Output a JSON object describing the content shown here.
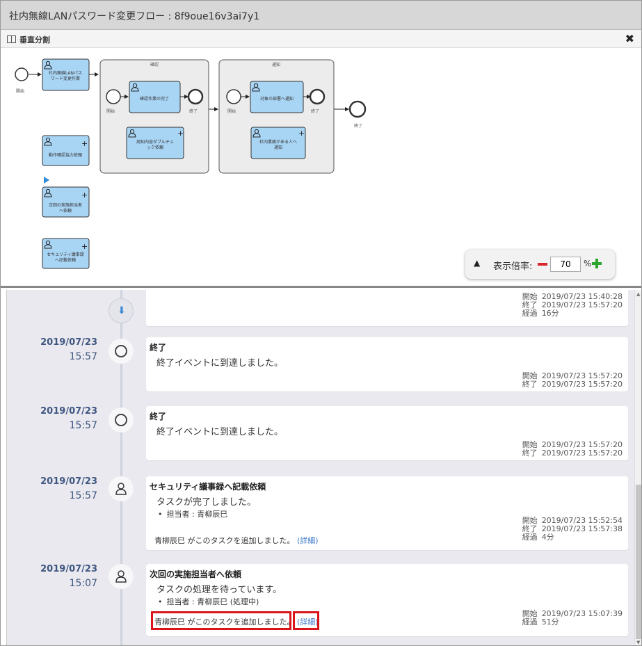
{
  "window": {
    "title": "社内無線LANパスワード変更フロー : 8f9oue16v3ai7y1"
  },
  "toolbar": {
    "split_label": "垂直分割",
    "close_label": "✖"
  },
  "diagram": {
    "start_label": "開始",
    "task1": [
      "社内無線LANパス",
      "ワード変更作業"
    ],
    "group1_title": "確認",
    "group1_start": "開始",
    "group1_task": "確認作業の完了",
    "group1_end": "終了",
    "group1_task2": [
      "周知内容ダブルチェ",
      "ック依頼"
    ],
    "group2_title": "通知",
    "group2_start": "開始",
    "group2_task": "対象の部署へ通知",
    "group2_end": "終了",
    "group2_task2": [
      "社内業務がある人へ",
      "通知"
    ],
    "end_label": "終了",
    "side_task1": "動作確認協力依頼",
    "side_task2": [
      "次回の実施担当者",
      "へ依頼"
    ],
    "side_task3": [
      "セキュリティ議事録",
      "へ記載依頼"
    ]
  },
  "zoom": {
    "label": "表示倍率:",
    "value": "70",
    "unit": "%"
  },
  "timeline": {
    "first": {
      "stats": [
        {
          "k": "開始",
          "v": "2019/07/23 15:40:28"
        },
        {
          "k": "終了",
          "v": "2019/07/23 15:57:20"
        },
        {
          "k": "経過",
          "v": "16分"
        }
      ]
    },
    "entries": [
      {
        "date": "2019/07/23",
        "time": "15:57",
        "title": "終了",
        "message": "終了イベントに到達しました。",
        "stats": [
          {
            "k": "開始",
            "v": "2019/07/23 15:57:20"
          },
          {
            "k": "終了",
            "v": "2019/07/23 15:57:20"
          }
        ]
      },
      {
        "date": "2019/07/23",
        "time": "15:57",
        "title": "終了",
        "message": "終了イベントに到達しました。",
        "stats": [
          {
            "k": "開始",
            "v": "2019/07/23 15:57:20"
          },
          {
            "k": "終了",
            "v": "2019/07/23 15:57:20"
          }
        ]
      },
      {
        "date": "2019/07/23",
        "time": "15:57",
        "title": "セキュリティ議事録へ記載依頼",
        "message": "タスクが完了しました。",
        "bullet": "担当者 : 青柳辰巳",
        "stats": [
          {
            "k": "開始",
            "v": "2019/07/23 15:52:54"
          },
          {
            "k": "終了",
            "v": "2019/07/23 15:57:38"
          },
          {
            "k": "経過",
            "v": "4分"
          }
        ],
        "footer_text": "青柳辰巳 がこのタスクを追加しました。",
        "footer_link": "(詳細)"
      },
      {
        "date": "2019/07/23",
        "time": "15:07",
        "title": "次回の実施担当者へ依頼",
        "message": "タスクの処理を待っています。",
        "bullet": "担当者 : 青柳辰巳 (処理中)",
        "stats": [
          {
            "k": "開始",
            "v": "2019/07/23 15:07:39"
          },
          {
            "k": "経過",
            "v": "51分"
          }
        ],
        "footer_text": "青柳辰巳 がこのタスクを追加しました。",
        "footer_link": "(詳細)"
      }
    ]
  }
}
